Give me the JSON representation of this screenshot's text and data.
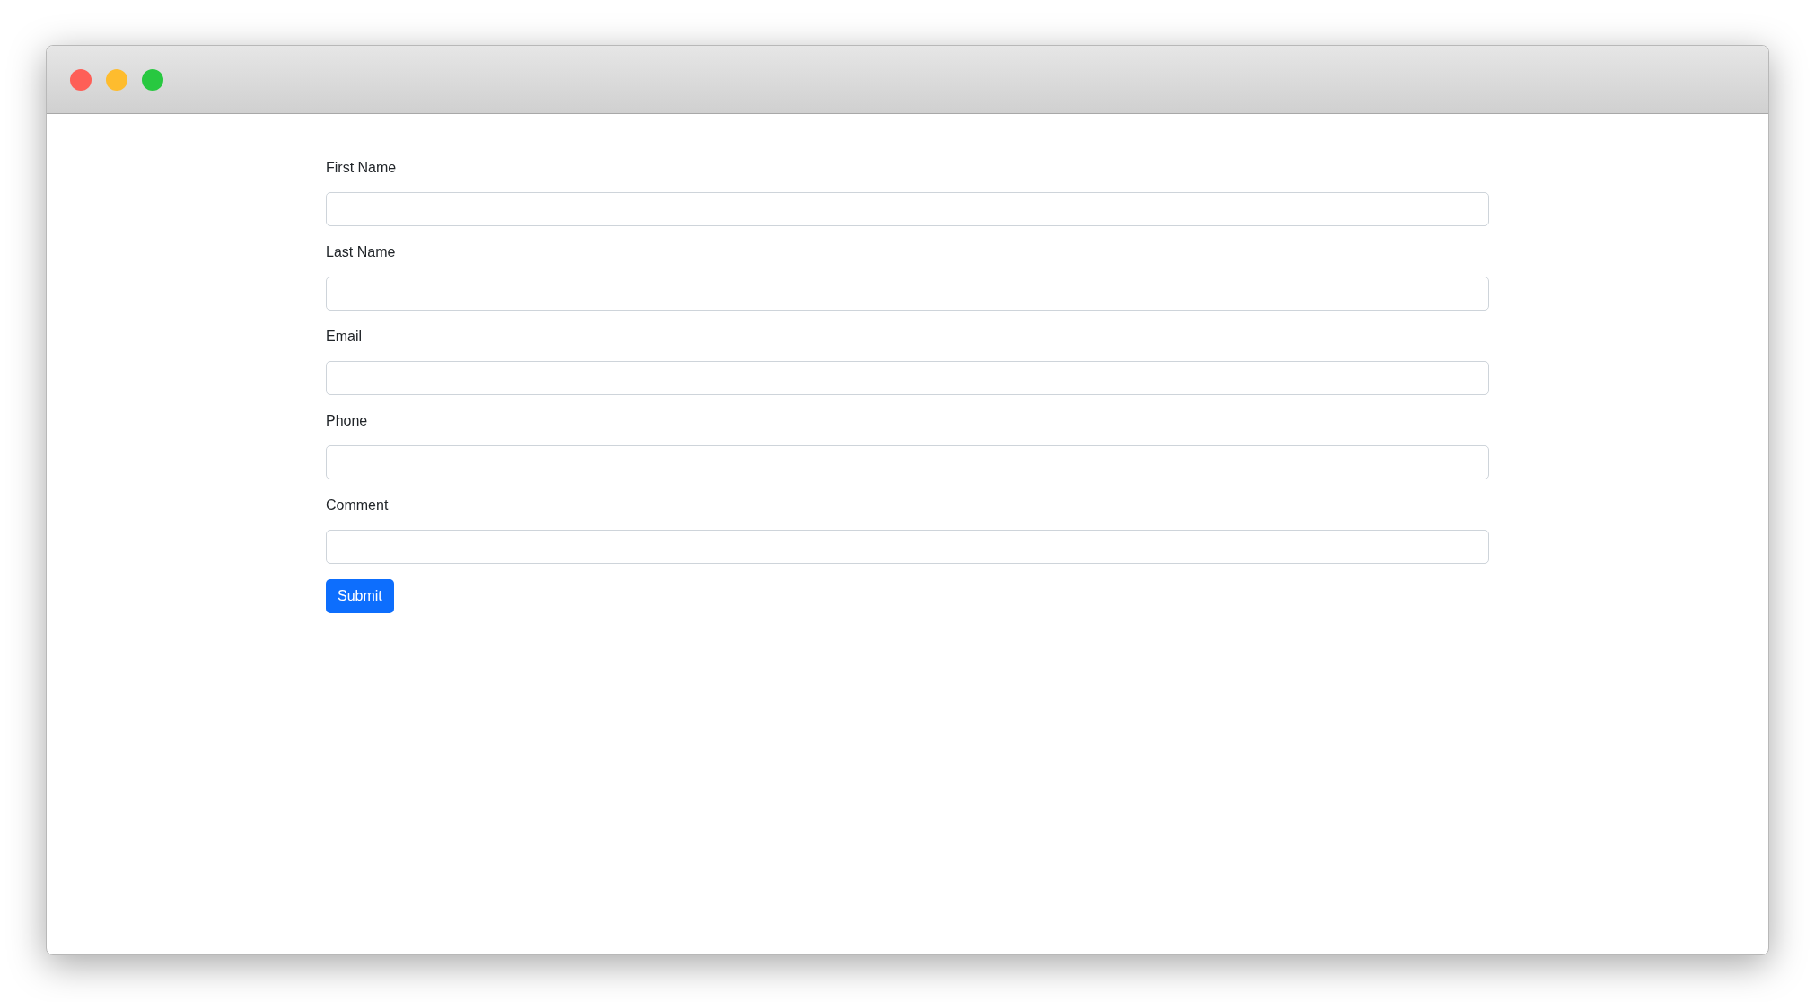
{
  "window": {
    "controls": [
      {
        "kind": "close"
      },
      {
        "kind": "minimize"
      },
      {
        "kind": "maximize"
      }
    ]
  },
  "form": {
    "fields": [
      {
        "label": "First Name"
      },
      {
        "label": "Last Name"
      },
      {
        "label": "Email"
      },
      {
        "label": "Phone"
      },
      {
        "label": "Comment"
      }
    ],
    "submit": "Submit"
  }
}
